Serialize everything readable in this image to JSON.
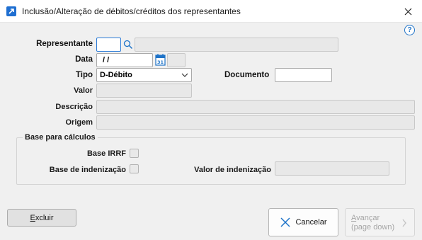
{
  "window": {
    "title": "Inclusão/Alteração de débitos/créditos dos representantes"
  },
  "form": {
    "representante_label": "Representante",
    "data_label": "Data",
    "data_value": " /  /",
    "tipo_label": "Tipo",
    "tipo_value": "D-Débito",
    "documento_label": "Documento",
    "valor_label": "Valor",
    "descricao_label": "Descrição",
    "origem_label": "Origem"
  },
  "base_calculos": {
    "title": "Base para cálculos",
    "base_irrf_label": "Base IRRF",
    "base_indenizacao_label": "Base de indenização",
    "valor_indenizacao_label": "Valor de indenização"
  },
  "buttons": {
    "excluir_first": "E",
    "excluir_rest": "xcluir",
    "cancelar": "Cancelar",
    "avancar_first": "A",
    "avancar_rest": "vançar",
    "avancar_sub": "(page down)"
  },
  "icons": {
    "help": "?"
  },
  "colors": {
    "accent": "#1e73c8",
    "focus_border": "#2a7ad6"
  }
}
